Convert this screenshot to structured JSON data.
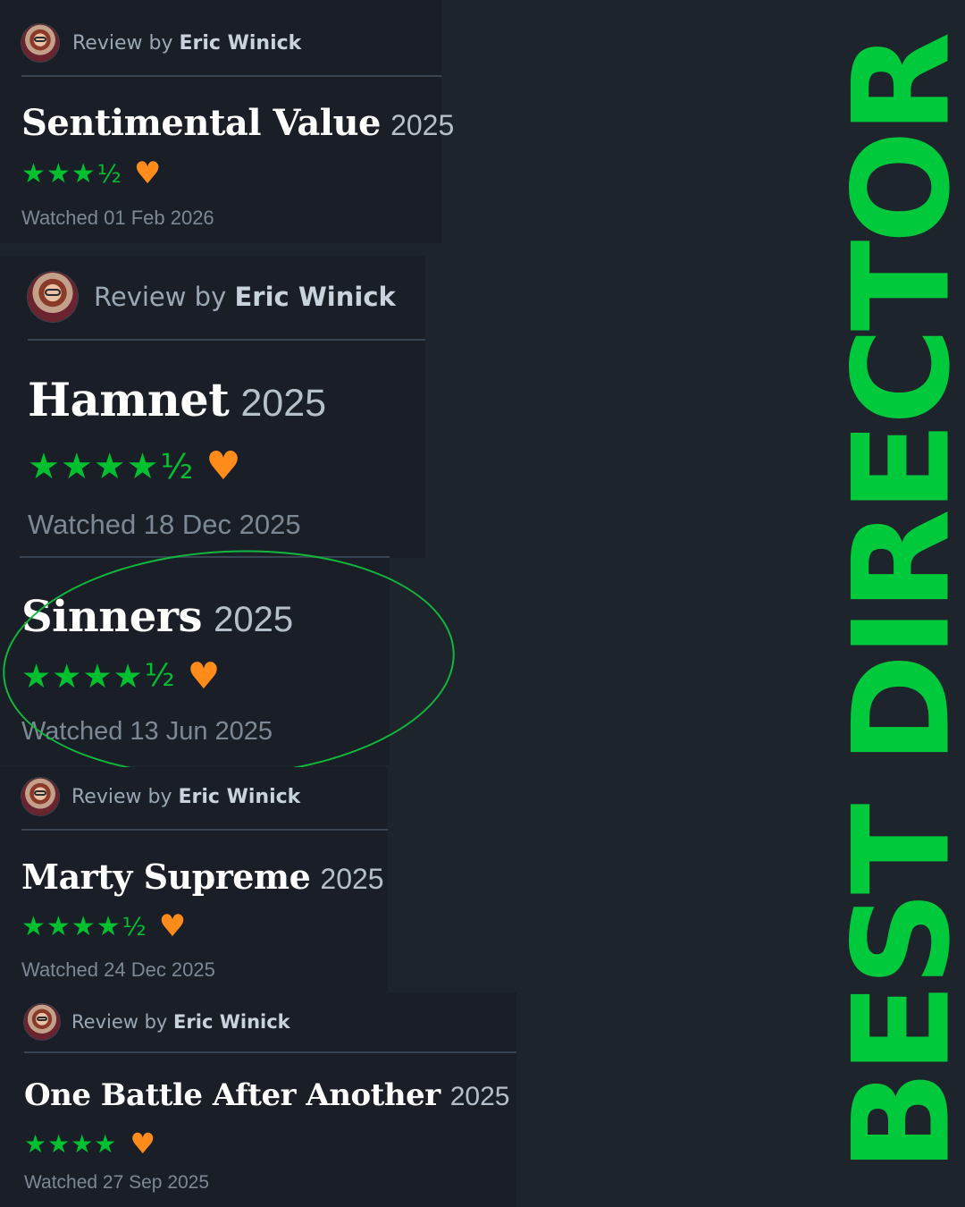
{
  "review_label": "Review by",
  "reviewer": "Eric Winick",
  "accent_green": "#00c93b",
  "heart_color": "#ff8c1a",
  "reviews": [
    {
      "title": "Sentimental Value",
      "year": "2025",
      "stars": "★★★",
      "half": "½",
      "heart": "♥",
      "watched": "Watched 01 Feb 2026"
    },
    {
      "title": "Hamnet",
      "year": "2025",
      "stars": "★★★★",
      "half": "½",
      "heart": "♥",
      "watched": "Watched 18 Dec 2025"
    },
    {
      "title": "Sinners",
      "year": "2025",
      "stars": "★★★★",
      "half": "½",
      "heart": "♥",
      "watched": "Watched 13 Jun 2025"
    },
    {
      "title": "Marty Supreme",
      "year": "2025",
      "stars": "★★★★",
      "half": "½",
      "heart": "♥",
      "watched": "Watched 24 Dec 2025"
    },
    {
      "title": "One Battle After Another",
      "year": "2025",
      "stars": "★★★★",
      "half": "",
      "heart": "♥",
      "watched": "Watched 27 Sep 2025"
    }
  ],
  "banner": "BEST DIRECTOR"
}
